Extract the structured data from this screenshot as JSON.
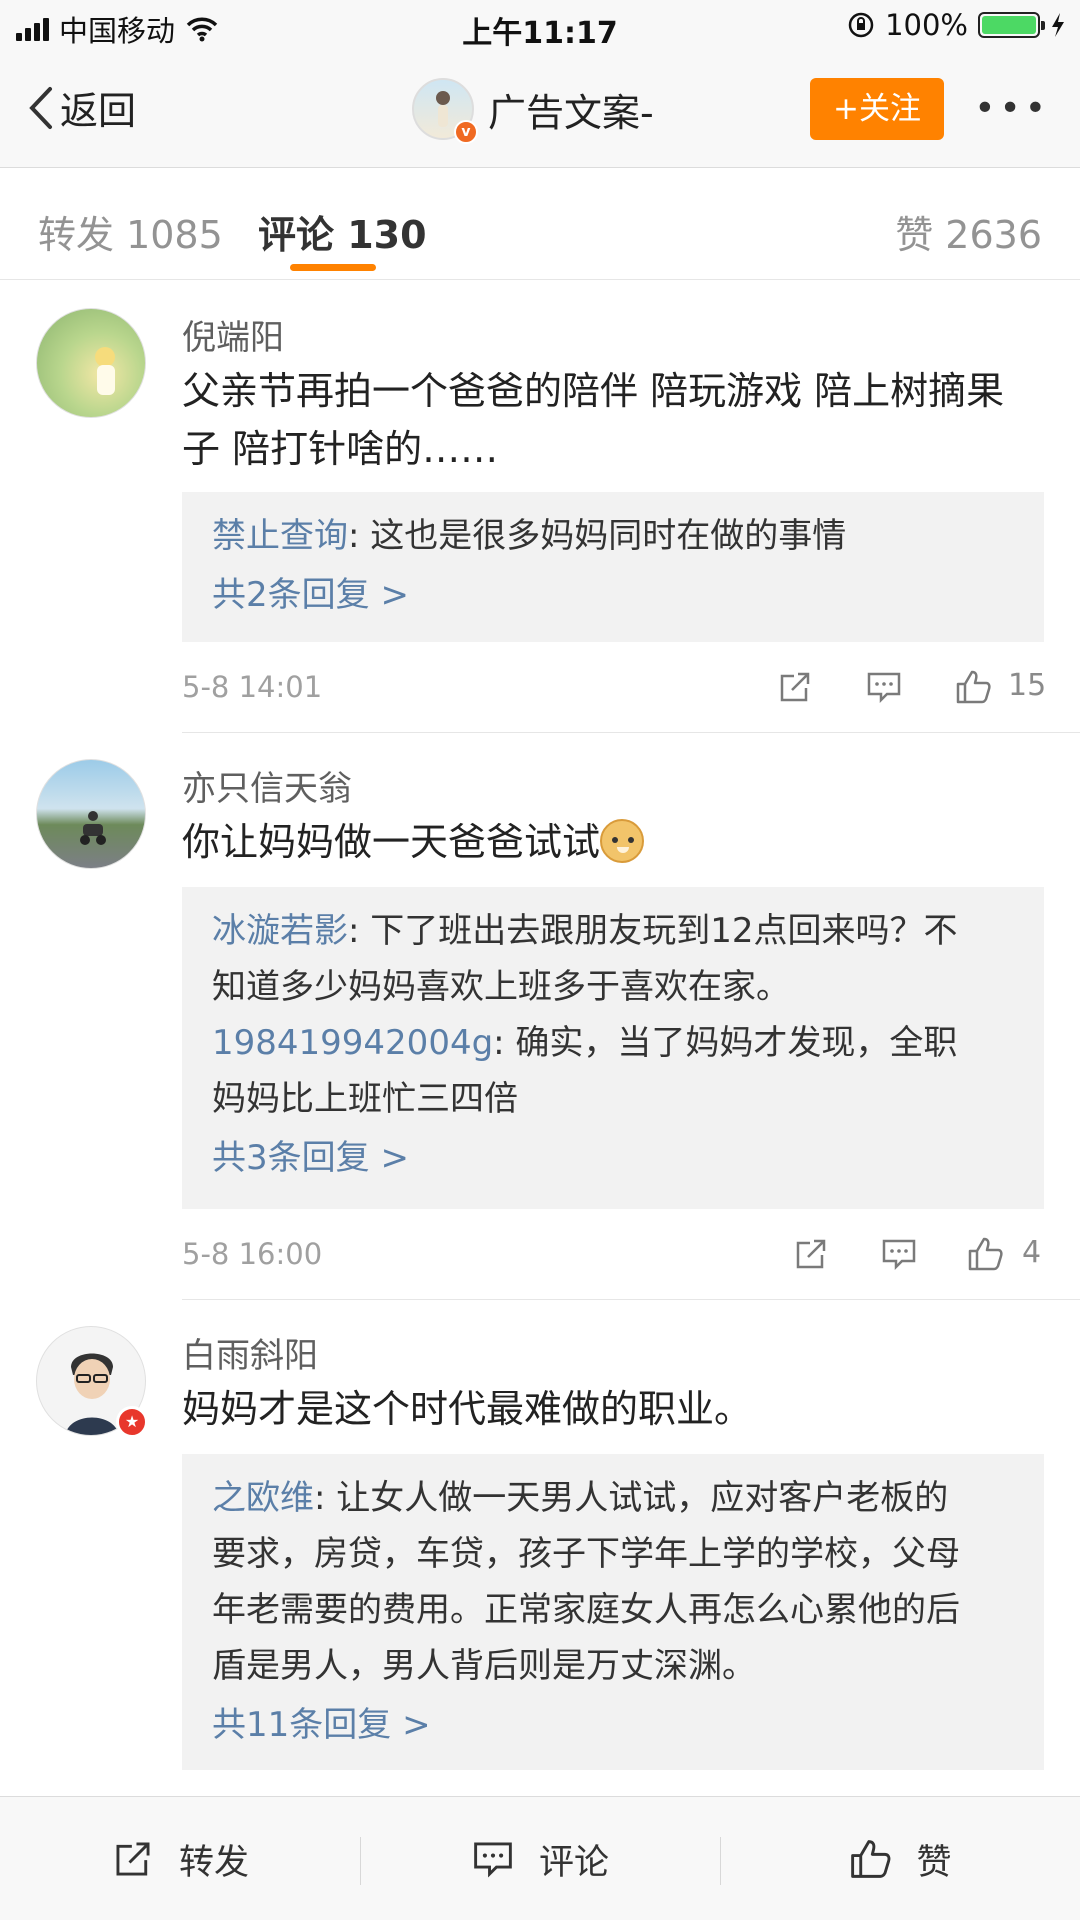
{
  "status_bar": {
    "carrier": "中国移动",
    "time": "上午11:17",
    "battery": "100%"
  },
  "nav": {
    "back_label": "返回",
    "title": "广告文案-",
    "follow_label": "+关注",
    "more_label": "•••"
  },
  "tabs": {
    "repost": "转发 1085",
    "comments": "评论 130",
    "likes": "赞 2636"
  },
  "comments": [
    {
      "user": "倪端阳",
      "text_line1": "父亲节再拍一个爸爸的陪伴 陪玩游戏 陪上树摘果",
      "text_line2": "子  陪打针啥的……",
      "replies": [
        {
          "user": "禁止查询",
          "text": ": 这也是很多妈妈同时在做的事情"
        }
      ],
      "reply_count": "共2条回复 >",
      "date": "5-8 14:01",
      "likes": "15"
    },
    {
      "user": "亦只信天翁",
      "text": "你让妈妈做一天爸爸试试",
      "replies": [
        {
          "user": "冰漩若影",
          "line1": ": 下了班出去跟朋友玩到12点回来吗？不",
          "line2": "知道多少妈妈喜欢上班多于喜欢在家。"
        },
        {
          "user": "198419942004g",
          "line1": ": 确实，当了妈妈才发现，全职",
          "line2": "妈妈比上班忙三四倍"
        }
      ],
      "reply_count": "共3条回复 >",
      "date": "5-8 16:00",
      "likes": "4"
    },
    {
      "user": "白雨斜阳",
      "text": "妈妈才是这个时代最难做的职业。",
      "replies": [
        {
          "user": "之欧维",
          "line1": ": 让女人做一天男人试试，应对客户老板的",
          "line2": "要求，房贷，车贷，孩子下学年上学的学校，父母",
          "line3": "年老需要的费用。正常家庭女人再怎么心累他的后",
          "line4": "盾是男人，男人背后则是万丈深渊。"
        }
      ],
      "reply_count": "共11条回复 >"
    }
  ],
  "bottom_bar": {
    "repost": "转发",
    "comment": "评论",
    "like": "赞"
  },
  "colors": {
    "accent": "#ff8200",
    "link": "#5b7fa8",
    "reply_bg": "#f2f2f2"
  }
}
